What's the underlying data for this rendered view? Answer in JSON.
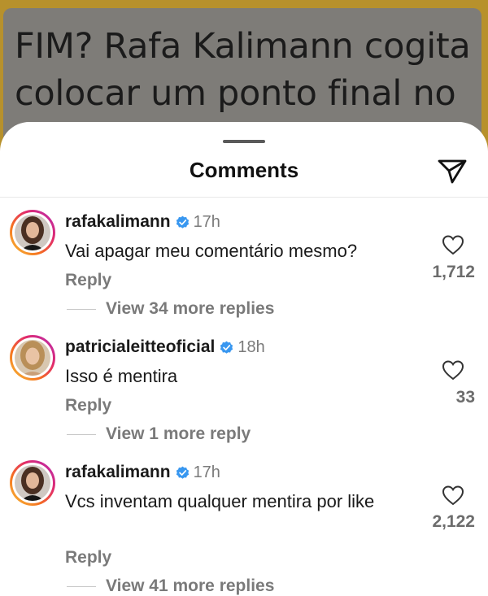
{
  "background_post": {
    "headline": "FIM? Rafa Kalimann cogita colocar um ponto final no relacionamento com Nattan"
  },
  "sheet": {
    "title": "Comments",
    "share_icon": "send-paper-plane-icon"
  },
  "comments": [
    {
      "username": "rafakalimann",
      "verified": true,
      "time": "17h",
      "text": "Vai apagar meu comentário mesmo?",
      "reply_label": "Reply",
      "likes": "1,712",
      "view_replies": "View 34 more replies"
    },
    {
      "username": "patricialeitteoficial",
      "verified": true,
      "time": "18h",
      "text": "Isso é mentira",
      "reply_label": "Reply",
      "likes": "33",
      "view_replies": "View 1 more reply"
    },
    {
      "username": "rafakalimann",
      "verified": true,
      "time": "17h",
      "text": "Vcs inventam qualquer mentira por like",
      "reply_label": "Reply",
      "likes": "2,122",
      "view_replies": "View 41 more replies"
    }
  ],
  "colors": {
    "verified_blue": "#3897f0",
    "secondary_text": "#7a7a7a"
  }
}
